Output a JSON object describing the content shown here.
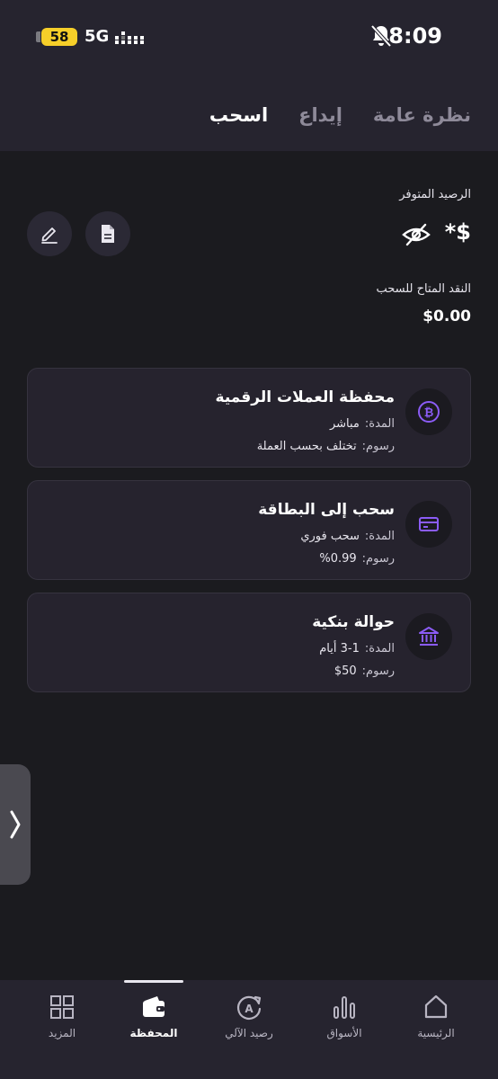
{
  "status_bar": {
    "time": "8:09",
    "battery": "58",
    "network": "5G"
  },
  "tabs": [
    {
      "label": "نظرة عامة",
      "active": false
    },
    {
      "label": "إيداع",
      "active": false
    },
    {
      "label": "اسحب",
      "active": true
    }
  ],
  "balance": {
    "label": "الرصيد المتوفر",
    "value": "*$"
  },
  "cash": {
    "label": "النقد المتاح للسحب",
    "value": "$0.00"
  },
  "methods": [
    {
      "title": "محفظة العملات الرقمية",
      "duration_label": "المدة:",
      "duration": "مباشر",
      "fee_label": "رسوم:",
      "fee": "تختلف بحسب العملة",
      "icon": "bitcoin-icon"
    },
    {
      "title": "سحب إلى البطاقة",
      "duration_label": "المدة:",
      "duration": "سحب فوري",
      "fee_label": "رسوم:",
      "fee": "0.99%",
      "icon": "card-icon"
    },
    {
      "title": "حوالة بنكية",
      "duration_label": "المدة:",
      "duration": "1-3 أيام",
      "fee_label": "رسوم:",
      "fee": "50$",
      "icon": "bank-icon"
    }
  ],
  "nav": [
    {
      "label": "الرئيسية",
      "icon": "home-icon",
      "active": false
    },
    {
      "label": "الأسواق",
      "icon": "markets-icon",
      "active": false
    },
    {
      "label": "رصيد الآلي",
      "icon": "auto-balance-icon",
      "active": false
    },
    {
      "label": "المحفظة",
      "icon": "wallet-icon",
      "active": true
    },
    {
      "label": "المزيد",
      "icon": "grid-icon",
      "active": false
    }
  ],
  "colors": {
    "accent": "#8b5cf6",
    "background": "#1b1b1f",
    "header": "#26242f",
    "card": "#26232e"
  }
}
